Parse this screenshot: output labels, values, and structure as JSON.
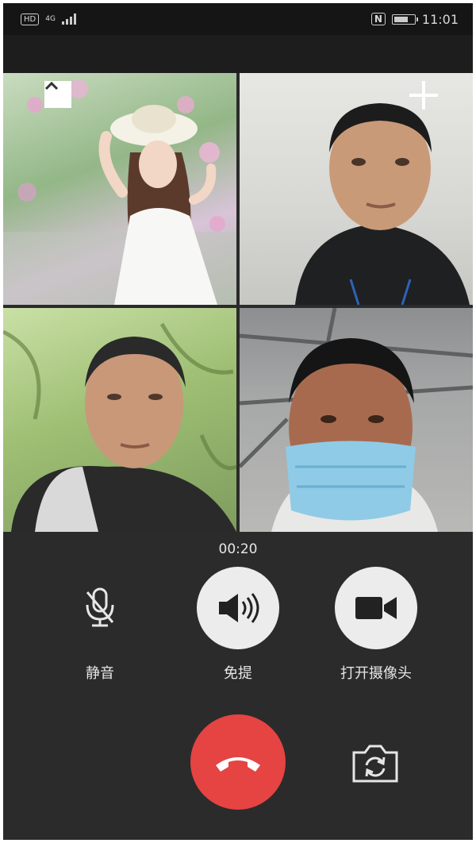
{
  "status_bar": {
    "hd": "HD",
    "network": "4G",
    "nfc": "N",
    "time": "11:01",
    "battery_level": 0.8
  },
  "call": {
    "timer": "00:20",
    "participants": [
      {
        "id": "participant-1",
        "description": "woman-in-white-hat"
      },
      {
        "id": "participant-2",
        "description": "man-in-black-jacket"
      },
      {
        "id": "participant-3",
        "description": "man-outdoors"
      },
      {
        "id": "participant-4",
        "description": "man-with-mask"
      }
    ]
  },
  "controls": {
    "mute_label": "静音",
    "speaker_label": "免提",
    "camera_label": "打开摄像头"
  },
  "icons": {
    "collapse": "chevron-up-icon",
    "add": "plus-icon",
    "mute": "mic-off-icon",
    "speaker": "speaker-icon",
    "camera": "video-camera-icon",
    "hangup": "phone-hangup-icon",
    "switch_camera": "camera-switch-icon"
  },
  "colors": {
    "hangup": "#e64343",
    "background": "#2b2b2b"
  }
}
